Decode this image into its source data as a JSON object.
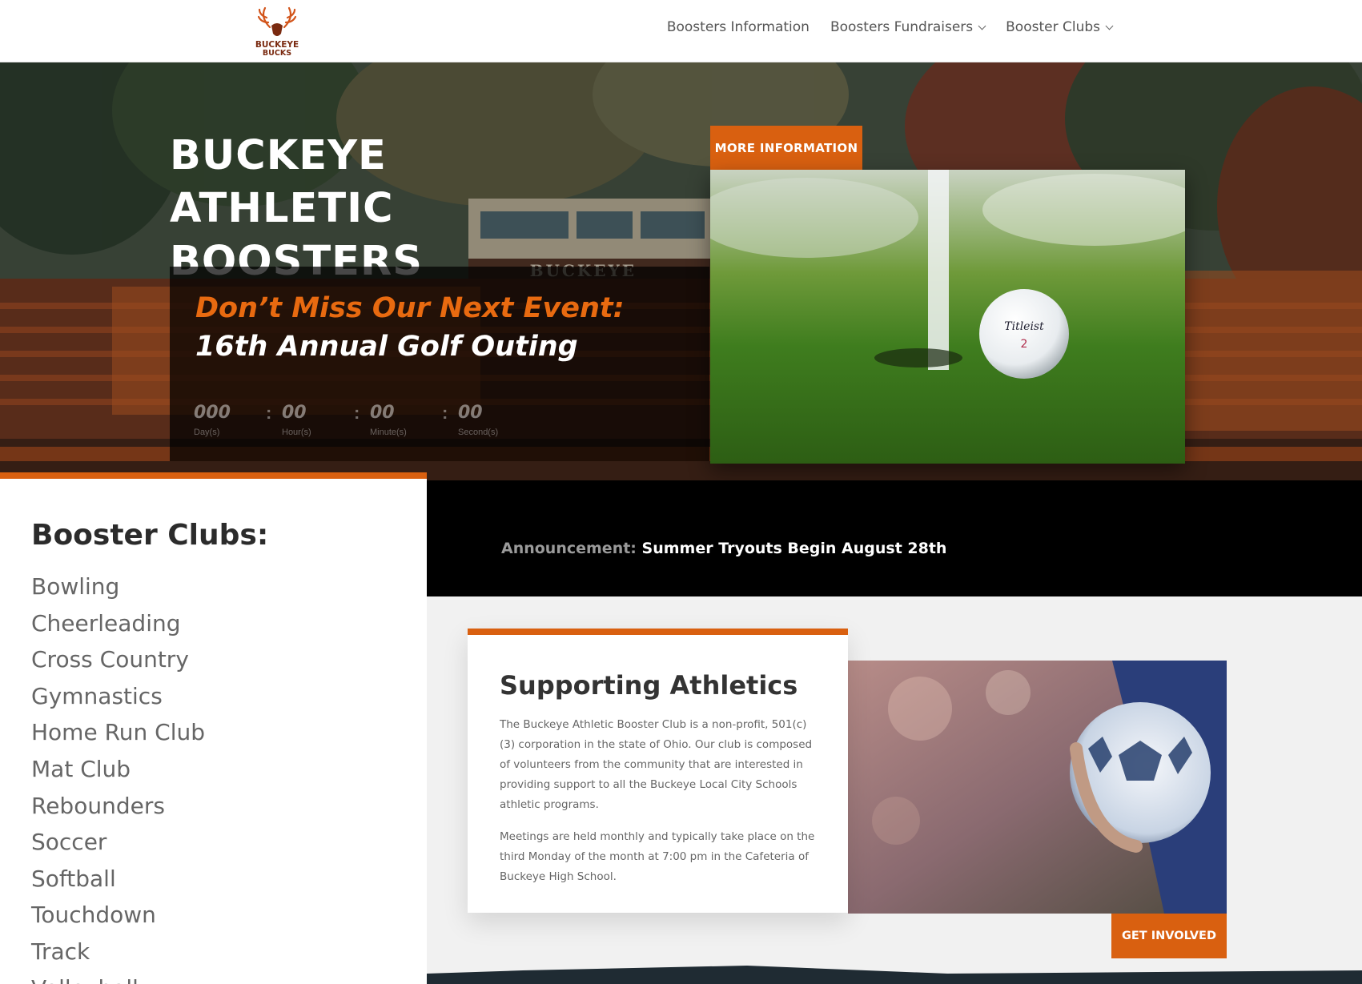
{
  "header": {
    "logo_text_line1": "BUCKEYE",
    "logo_text_line2": "BUCKS",
    "nav": [
      {
        "label": "Boosters Information",
        "has_dropdown": false
      },
      {
        "label": "Boosters Fundraisers",
        "has_dropdown": true
      },
      {
        "label": "Booster Clubs",
        "has_dropdown": true
      }
    ]
  },
  "hero": {
    "title": "BUCKEYE ATHLETIC BOOSTERS",
    "press_box_sign": "BUCKEYE",
    "event_heading": "Don’t Miss Our Next Event:",
    "event_name": "16th Annual Golf Outing",
    "countdown": [
      {
        "value": "000",
        "label": "Day(s)"
      },
      {
        "value": "00",
        "label": "Hour(s)"
      },
      {
        "value": "00",
        "label": "Minute(s)"
      },
      {
        "value": "00",
        "label": "Second(s)"
      }
    ],
    "countdown_separator": ":",
    "more_button": "MORE INFORMATION",
    "golf_ball_text": "Titleist",
    "golf_ball_number": "2"
  },
  "announcement": {
    "label": "Announcement:",
    "text": "Summer Tryouts Begin August 28th"
  },
  "clubs": {
    "title": "Booster Clubs:",
    "items": [
      "Bowling",
      "Cheerleading",
      "Cross Country",
      "Gymnastics",
      "Home Run Club",
      "Mat Club",
      "Rebounders",
      "Soccer",
      "Softball",
      "Touchdown",
      "Track",
      "Volleyball"
    ]
  },
  "support": {
    "title": "Supporting Athletics",
    "paragraphs": [
      "The Buckeye Athletic Booster Club is a non-profit, 501(c)(3) corporation in the state of Ohio. Our club is composed of volunteers from the community that are interested in providing support to all the Buckeye Local City Schools athletic programs.",
      "Meetings are held monthly and typically take place on the third Monday of the month at 7:00 pm in the Cafeteria of Buckeye High School."
    ],
    "get_involved_button": "GET INVOLVED"
  },
  "colors": {
    "accent": "#d96010",
    "dark": "#000000",
    "text_dark": "#2b2b2b",
    "text_muted": "#666666"
  }
}
